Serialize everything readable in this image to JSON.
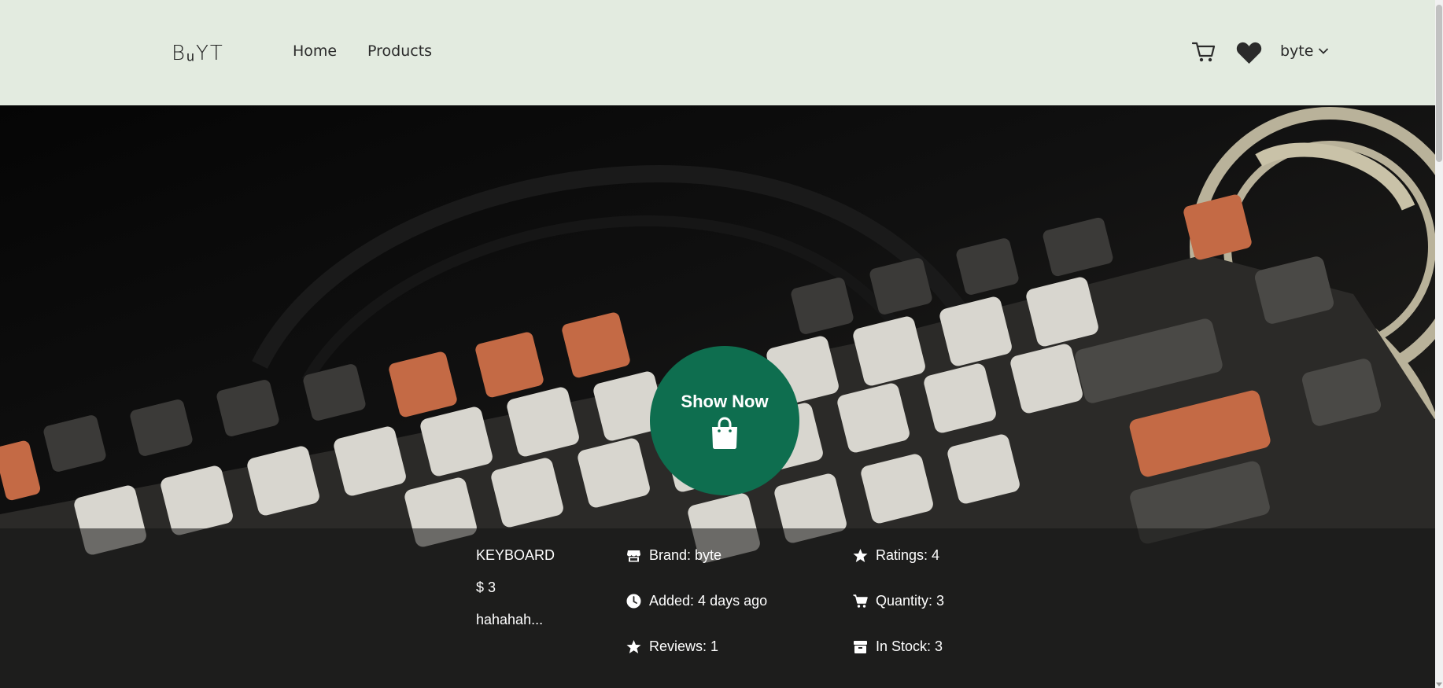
{
  "header": {
    "logo": "BᵤYT",
    "nav": [
      {
        "label": "Home"
      },
      {
        "label": "Products"
      }
    ],
    "user": {
      "label": "byte"
    }
  },
  "hero": {
    "cta_label": "Show Now"
  },
  "product": {
    "name": "KEYBOARD",
    "price": "$ 3",
    "description": "hahahah...",
    "brand": "Brand: byte",
    "added": "Added: 4 days ago",
    "reviews": "Reviews: 1",
    "ratings": "Ratings: 4",
    "quantity": "Quantity: 3",
    "in_stock": "In Stock: 3"
  },
  "colors": {
    "header_bg": "#e3ebe0",
    "cta_bg": "#0e6e4f"
  },
  "icons": [
    "cart-icon",
    "heart-icon",
    "chevron-down-icon",
    "shopping-bag-icon",
    "store-icon",
    "clock-icon",
    "star-icon",
    "box-icon"
  ]
}
